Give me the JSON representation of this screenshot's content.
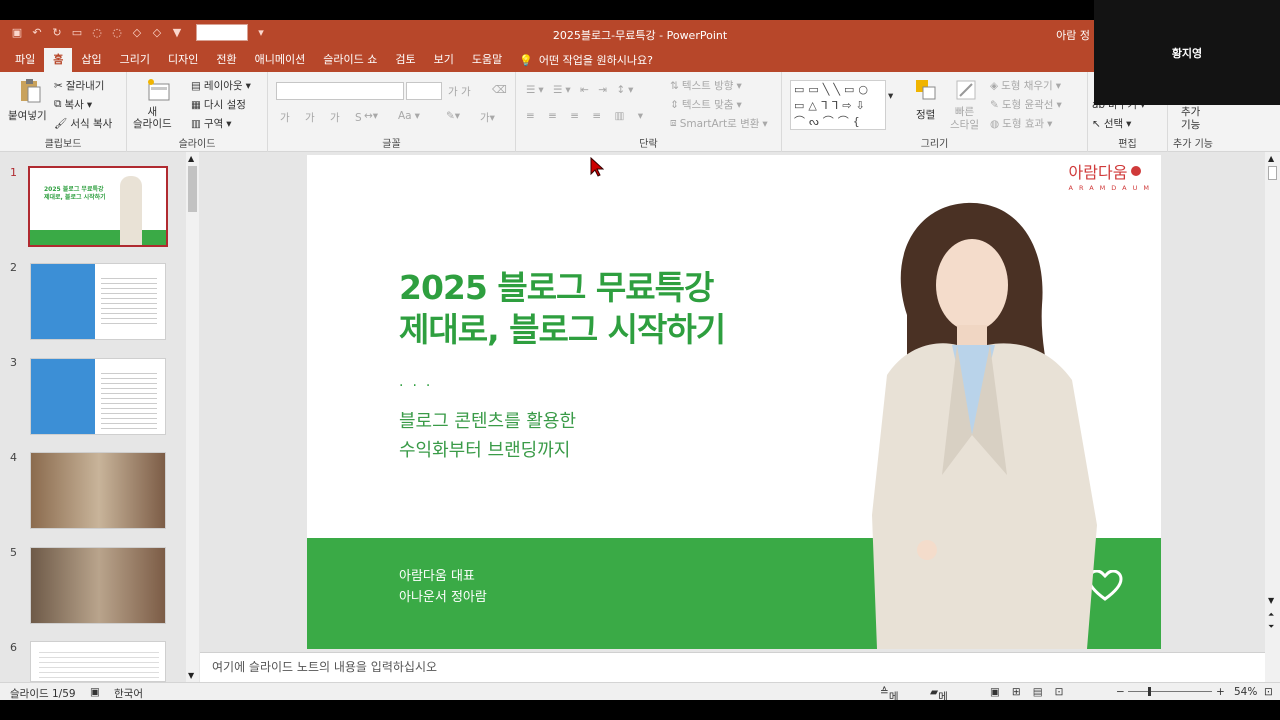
{
  "window": {
    "title": "2025블로그-무료특강  -  PowerPoint",
    "user": "아람 정"
  },
  "qat": {
    "icons": [
      "save-icon",
      "undo-icon",
      "redo-icon",
      "present-icon",
      "format-icon"
    ]
  },
  "tabs": [
    "파일",
    "홈",
    "삽입",
    "그리기",
    "디자인",
    "전환",
    "애니메이션",
    "슬라이드 쇼",
    "검토",
    "보기",
    "도움말"
  ],
  "active_tab": "홈",
  "tell_me": "어떤 작업을 원하시나요?",
  "ribbon": {
    "clipboard": {
      "paste": "붙여넣기",
      "cut": "잘라내기",
      "copy": "복사",
      "format_painter": "서식 복사",
      "group": "클립보드"
    },
    "slides": {
      "new_slide_line1": "새",
      "new_slide_line2": "슬라이드",
      "layout": "레이아웃",
      "reset": "다시 설정",
      "section": "구역",
      "group": "슬라이드"
    },
    "font": {
      "group": "글꼴",
      "aa": "Aa"
    },
    "paragraph": {
      "text_direction": "텍스트 방향",
      "align_text": "텍스트 맞춤",
      "smartart": "SmartArt로 변환",
      "group": "단락"
    },
    "drawing": {
      "arrange": "정렬",
      "quick_styles_1": "빠른",
      "quick_styles_2": "스타일",
      "fill": "도형 채우기",
      "outline": "도형 윤곽선",
      "effects": "도형 효과",
      "group": "그리기"
    },
    "editing": {
      "replace": "바꾸기",
      "select": "선택",
      "group": "편집"
    },
    "addins": {
      "label_1": "추가",
      "label_2": "기능",
      "group": "추가 기능"
    }
  },
  "video": {
    "name": "황지영"
  },
  "thumbnails": [
    {
      "num": "1",
      "selected": true
    },
    {
      "num": "2",
      "selected": false
    },
    {
      "num": "3",
      "selected": false
    },
    {
      "num": "4",
      "selected": false
    },
    {
      "num": "5",
      "selected": false
    },
    {
      "num": "6",
      "selected": false
    }
  ],
  "slide": {
    "logo_ko": "아람다움",
    "logo_en": "ARAMDAUM",
    "title_line1": "2025 블로그 무료특강",
    "title_line2": "제대로, 블로그 시작하기",
    "dots": "...",
    "subtitle_line1": "블로그 콘텐츠를 활용한",
    "subtitle_line2": "수익화부터 브랜딩까지",
    "presenter_line1": "아람다움 대표",
    "presenter_line2": "아나운서 정아람",
    "band_color": "#3aaa46",
    "title_color": "#2e9f3f"
  },
  "notes_placeholder": "여기에 슬라이드 노트의 내용을 입력하십시오",
  "status": {
    "slide_counter": "슬라이드 1/59",
    "language": "한국어",
    "notes1": "메모",
    "notes2": "메모",
    "zoom": "54%"
  }
}
